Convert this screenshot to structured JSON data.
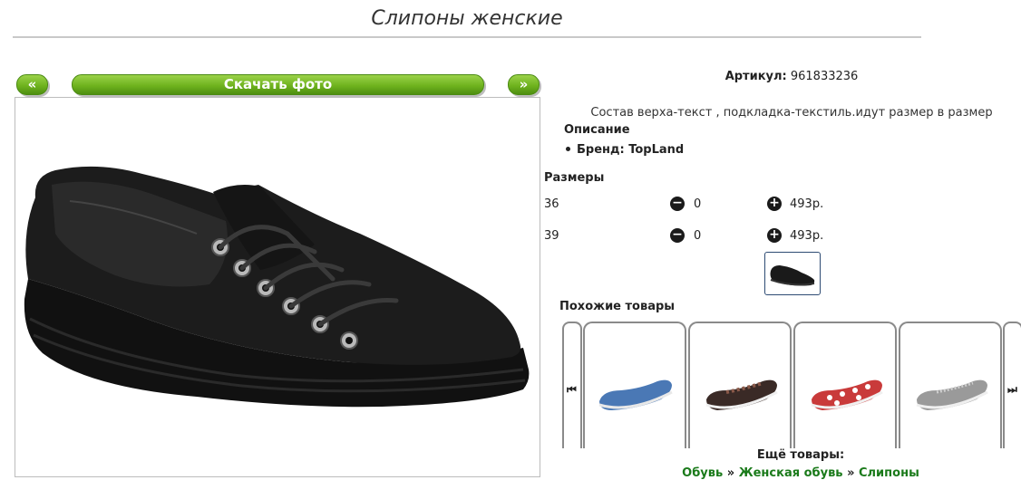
{
  "title": "Слипоны женские",
  "buttons": {
    "prev": "«",
    "download": "Скачать фото",
    "next": "»"
  },
  "sku": {
    "label": "Артикул:",
    "value": "961833236"
  },
  "composition": "Состав верха-текст , подкладка-текстиль.идут размер в размер",
  "description": {
    "heading": "Описание",
    "brand": "Бренд: TopLand"
  },
  "sizes": {
    "heading": "Размеры",
    "rows": [
      {
        "size": "36",
        "qty": "0",
        "price": "493р."
      },
      {
        "size": "39",
        "qty": "0",
        "price": "493р."
      }
    ]
  },
  "similar": {
    "heading": "Похожие товары"
  },
  "more": {
    "heading": "Ещё товары:",
    "crumbs": [
      "Обувь",
      "Женская обувь",
      "Слипоны"
    ],
    "separator": "»"
  },
  "icons": {
    "minus": "minus-circle-icon",
    "plus": "plus-circle-icon",
    "left": "skip-left-icon",
    "right": "skip-right-icon"
  },
  "colors": {
    "accent_green": "#6fb31e",
    "link_green": "#1a7a1a",
    "thumb_border": "#2d4b73"
  }
}
